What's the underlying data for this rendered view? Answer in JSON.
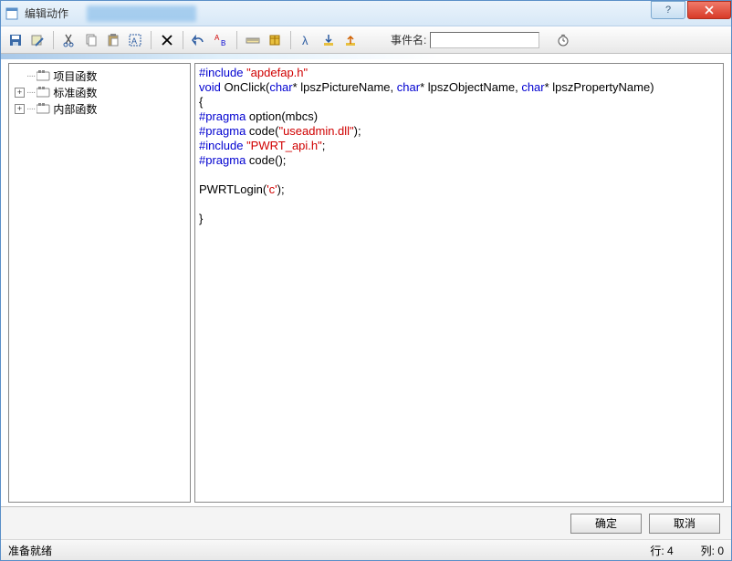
{
  "window": {
    "title": "编辑动作"
  },
  "toolbar": {
    "event_label": "事件名:",
    "event_value": ""
  },
  "tree": {
    "items": [
      {
        "label": "项目函数",
        "expandable": false
      },
      {
        "label": "标准函数",
        "expandable": true
      },
      {
        "label": "内部函数",
        "expandable": true
      }
    ]
  },
  "code": {
    "tokens": [
      [
        {
          "t": "#include",
          "c": "k"
        },
        {
          "t": " ",
          "c": "p"
        },
        {
          "t": "\"apdefap.h\"",
          "c": "s"
        }
      ],
      [
        {
          "t": "void",
          "c": "k"
        },
        {
          "t": " OnClick(",
          "c": "p"
        },
        {
          "t": "char",
          "c": "k"
        },
        {
          "t": "* lpszPictureName, ",
          "c": "p"
        },
        {
          "t": "char",
          "c": "k"
        },
        {
          "t": "* lpszObjectName, ",
          "c": "p"
        },
        {
          "t": "char",
          "c": "k"
        },
        {
          "t": "* lpszPropertyName)",
          "c": "p"
        }
      ],
      [
        {
          "t": "{",
          "c": "p"
        }
      ],
      [
        {
          "t": "#pragma",
          "c": "k"
        },
        {
          "t": " option(mbcs)",
          "c": "p"
        }
      ],
      [
        {
          "t": "#pragma",
          "c": "k"
        },
        {
          "t": " code(",
          "c": "p"
        },
        {
          "t": "\"useadmin.dll\"",
          "c": "s"
        },
        {
          "t": ");",
          "c": "p"
        }
      ],
      [
        {
          "t": "#include",
          "c": "k"
        },
        {
          "t": " ",
          "c": "p"
        },
        {
          "t": "\"PWRT_api.h\"",
          "c": "s"
        },
        {
          "t": ";",
          "c": "p"
        }
      ],
      [
        {
          "t": "#pragma",
          "c": "k"
        },
        {
          "t": " code();",
          "c": "p"
        }
      ],
      [
        {
          "t": "",
          "c": "p"
        }
      ],
      [
        {
          "t": "PWRTLogin(",
          "c": "p"
        },
        {
          "t": "'c'",
          "c": "s"
        },
        {
          "t": ");",
          "c": "p"
        }
      ],
      [
        {
          "t": "",
          "c": "p"
        }
      ],
      [
        {
          "t": "}",
          "c": "p"
        }
      ]
    ]
  },
  "buttons": {
    "ok": "确定",
    "cancel": "取消"
  },
  "status": {
    "ready": "准备就绪",
    "line": "行: 4",
    "col": "列: 0"
  }
}
